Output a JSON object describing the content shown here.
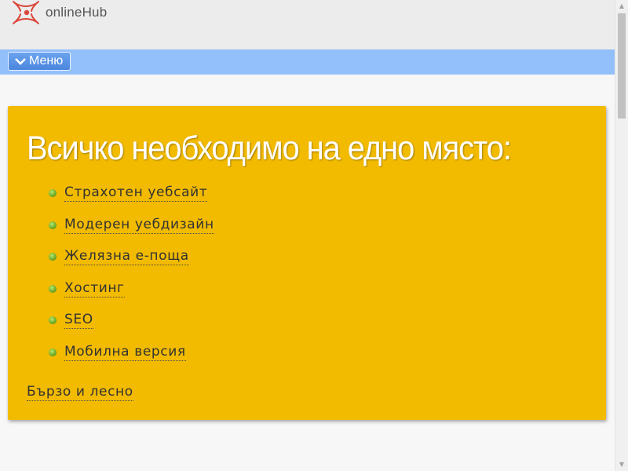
{
  "header": {
    "brand": "onlineHub",
    "logo_icon": "onlinehub-logo-icon",
    "logo_color": "#d9473a"
  },
  "nav": {
    "menu_label": "Меню",
    "menu_icon": "chevron-down-icon",
    "bar_color": "#93c0fb"
  },
  "hero": {
    "title": "Всичко необходимо на едно място:",
    "background_color": "#f2bb00",
    "items": [
      {
        "label": "Страхотен уебсайт"
      },
      {
        "label": "Модерен уебдизайн"
      },
      {
        "label": "Желязна е-поща"
      },
      {
        "label": "Хостинг"
      },
      {
        "label": "SEO"
      },
      {
        "label": "Мобилна версия"
      }
    ],
    "footer_link": "Бързо и лесно"
  }
}
